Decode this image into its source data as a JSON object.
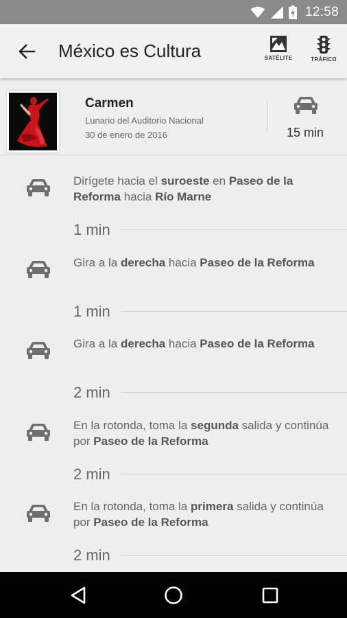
{
  "status_bar": {
    "time": "12:58",
    "icons": [
      "wifi-icon",
      "signal-icon",
      "battery-charging-icon"
    ]
  },
  "app_bar": {
    "back_icon": "arrow-back-icon",
    "title": "México es Cultura",
    "actions": [
      {
        "label": "SATÉLITE",
        "icon": "satellite-icon"
      },
      {
        "label": "TRÁFICO",
        "icon": "traffic-light-icon"
      }
    ]
  },
  "event": {
    "title": "Carmen",
    "venue": "Lunario del Auditorio Nacional",
    "date": "30 de enero de 2016",
    "travel_time": "15 min",
    "travel_icon": "car-icon",
    "thumbnail": "dancer-image"
  },
  "directions": [
    {
      "icon": "car-icon",
      "parts": [
        [
          "Dirígete hacia el ",
          false
        ],
        [
          "suroeste",
          true
        ],
        [
          " en ",
          false
        ],
        [
          "Paseo de la Reforma",
          true
        ],
        [
          " hacia ",
          false
        ],
        [
          "Río Marne",
          true
        ]
      ],
      "duration": "1 min"
    },
    {
      "icon": "car-icon",
      "parts": [
        [
          "Gira a la ",
          false
        ],
        [
          "derecha",
          true
        ],
        [
          " hacia ",
          false
        ],
        [
          "Paseo de la Reforma",
          true
        ]
      ],
      "duration": "1 min"
    },
    {
      "icon": "car-icon",
      "parts": [
        [
          "Gira a la ",
          false
        ],
        [
          "derecha",
          true
        ],
        [
          " hacia ",
          false
        ],
        [
          "Paseo de la Reforma",
          true
        ]
      ],
      "duration": "2 min"
    },
    {
      "icon": "car-icon",
      "parts": [
        [
          "En la rotonda, toma la ",
          false
        ],
        [
          "segunda",
          true
        ],
        [
          " salida y continúa por ",
          false
        ],
        [
          "Paseo de la Reforma",
          true
        ]
      ],
      "duration": "2 min"
    },
    {
      "icon": "car-icon",
      "parts": [
        [
          "En la rotonda, toma la ",
          false
        ],
        [
          "primera",
          true
        ],
        [
          " salida y continúa por ",
          false
        ],
        [
          "Paseo de la Reforma",
          true
        ]
      ],
      "duration": "2 min"
    }
  ],
  "nav_bar": {
    "buttons": [
      "back-triangle-icon",
      "home-circle-icon",
      "recents-square-icon"
    ]
  },
  "colors": {
    "status_bar": "#8a8a8a",
    "app_bar": "#f1f1f1",
    "background": "#eeeeee",
    "icon_gray": "#6e6e6e",
    "nav_bar": "#000000"
  }
}
